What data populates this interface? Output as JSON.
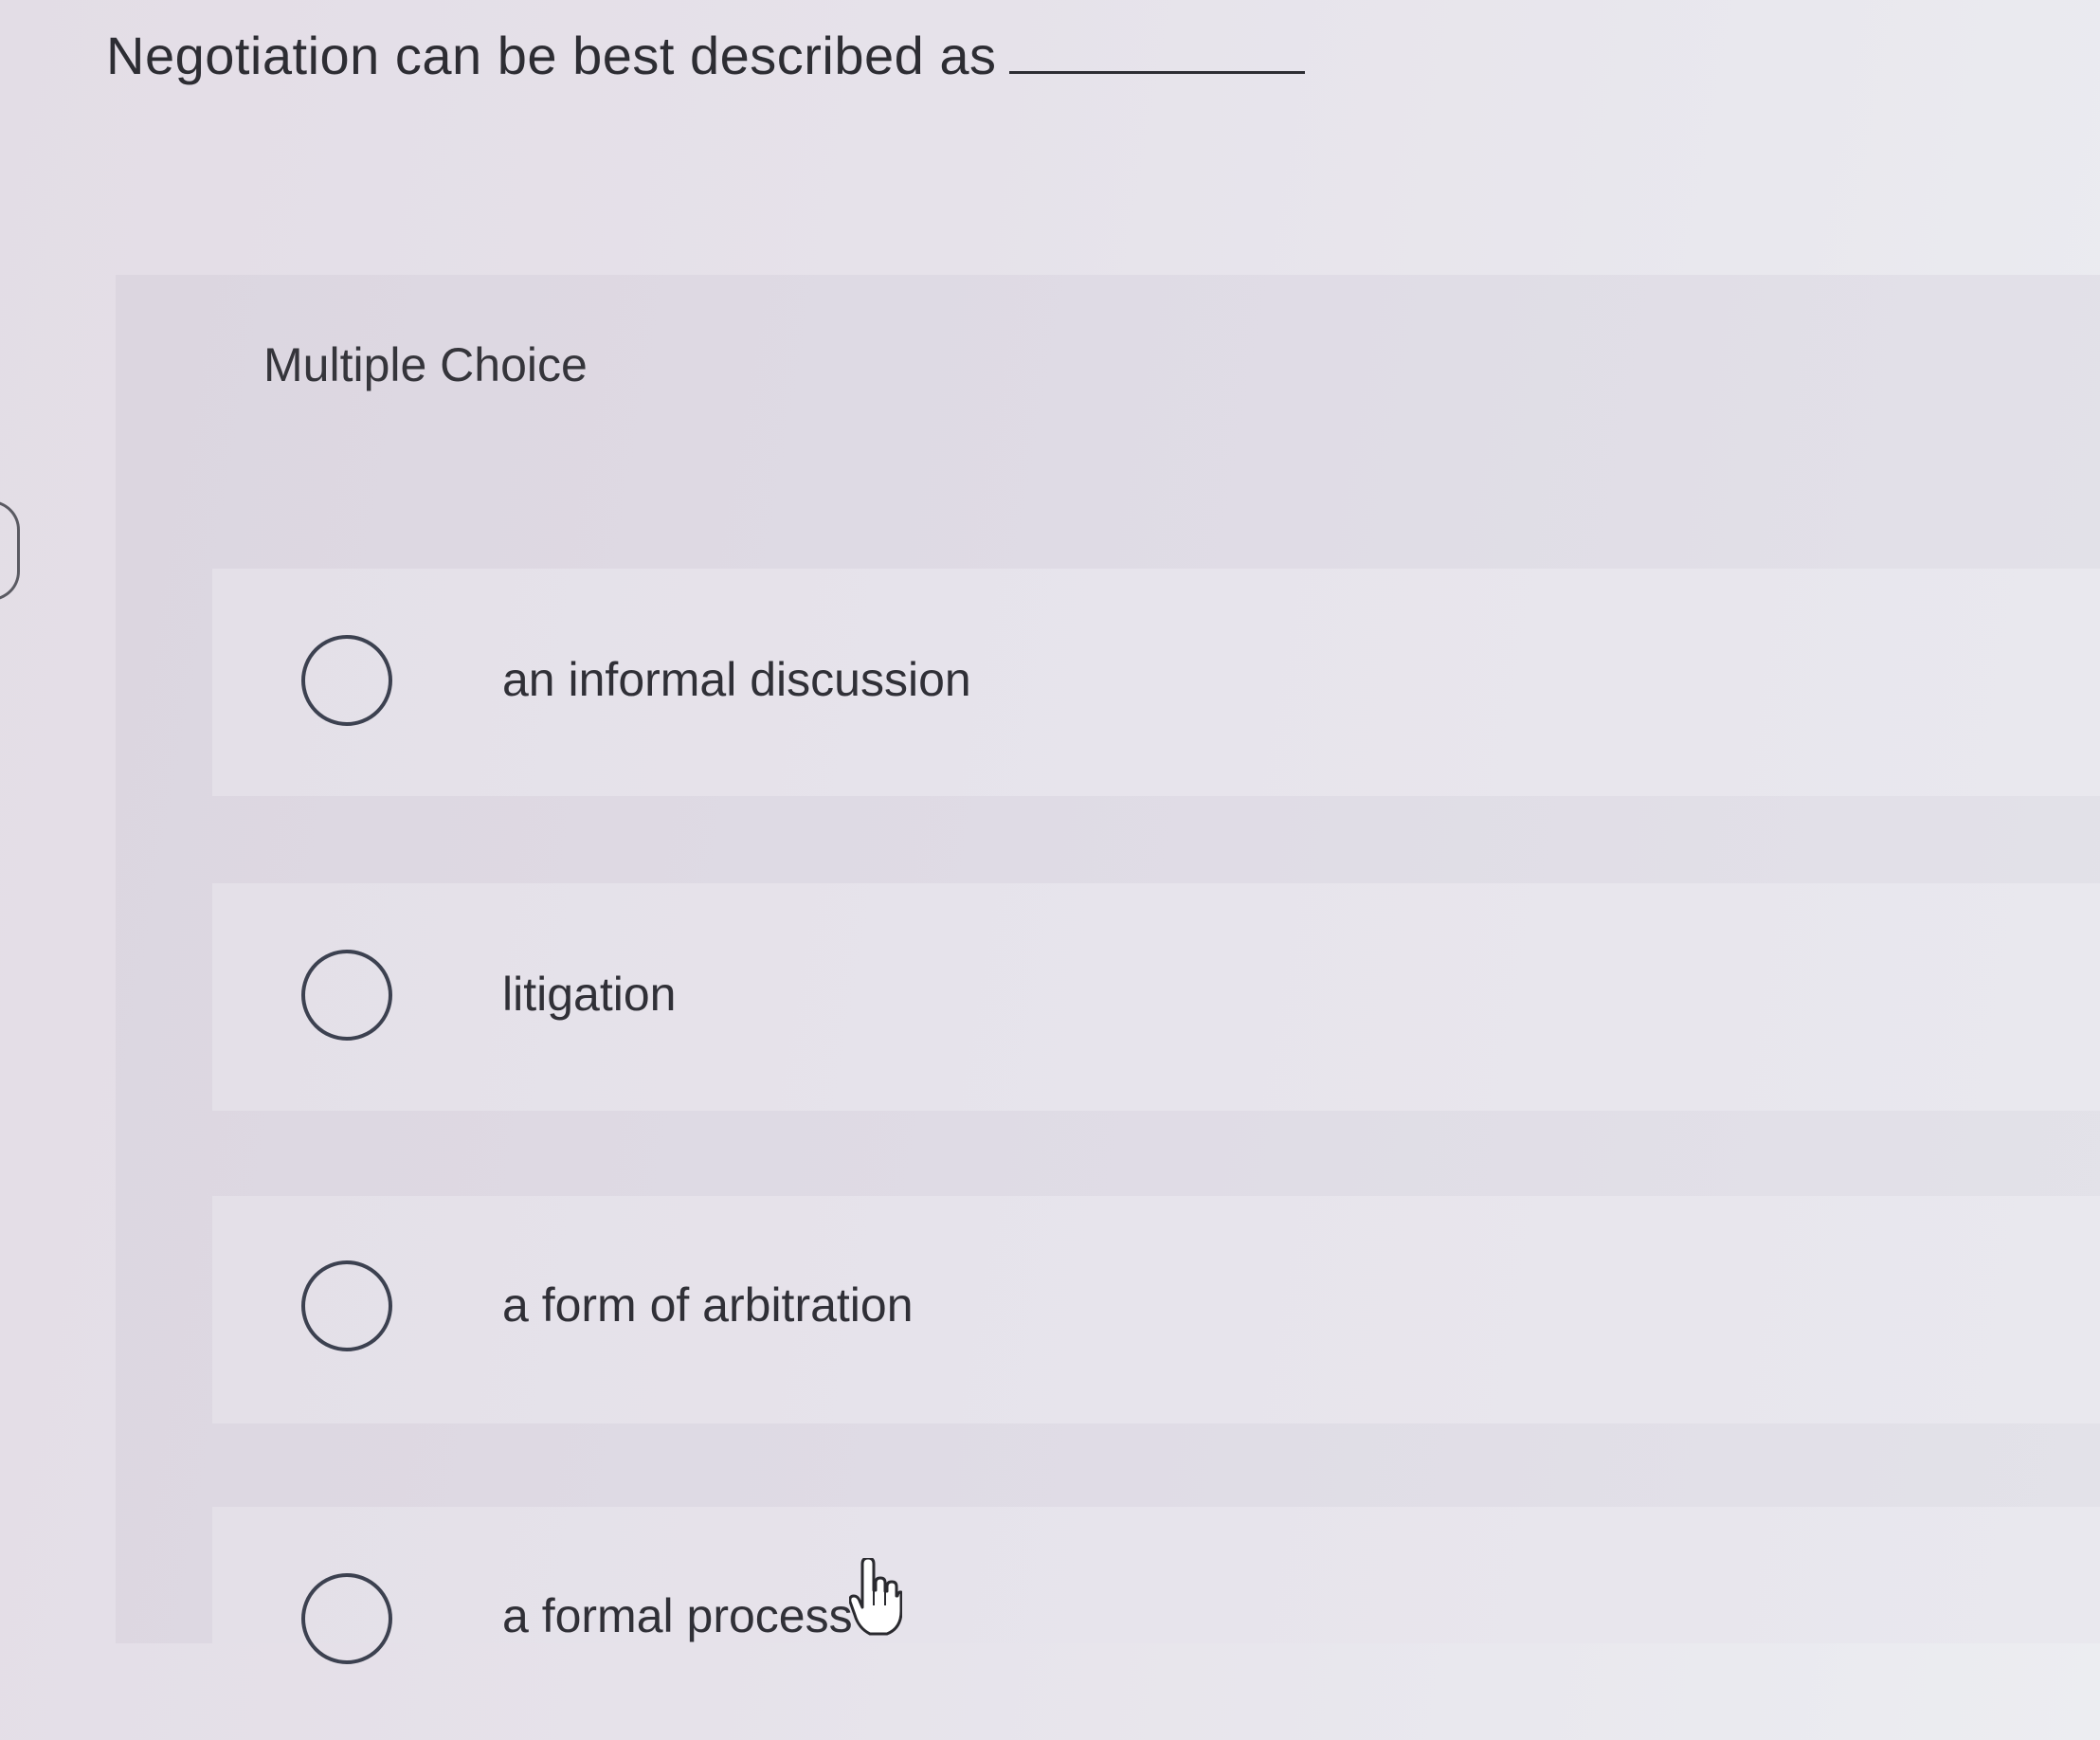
{
  "question": {
    "stem": "Negotiation can be best described as"
  },
  "panel": {
    "label": "Multiple Choice"
  },
  "options": [
    {
      "label": "an informal discussion",
      "selected": false
    },
    {
      "label": "litigation",
      "selected": false
    },
    {
      "label": "a form of arbitration",
      "selected": false
    },
    {
      "label": "a formal process",
      "selected": false
    }
  ],
  "icons": {
    "radio": "radio-circle-icon",
    "cursor": "hand-pointer-icon"
  }
}
